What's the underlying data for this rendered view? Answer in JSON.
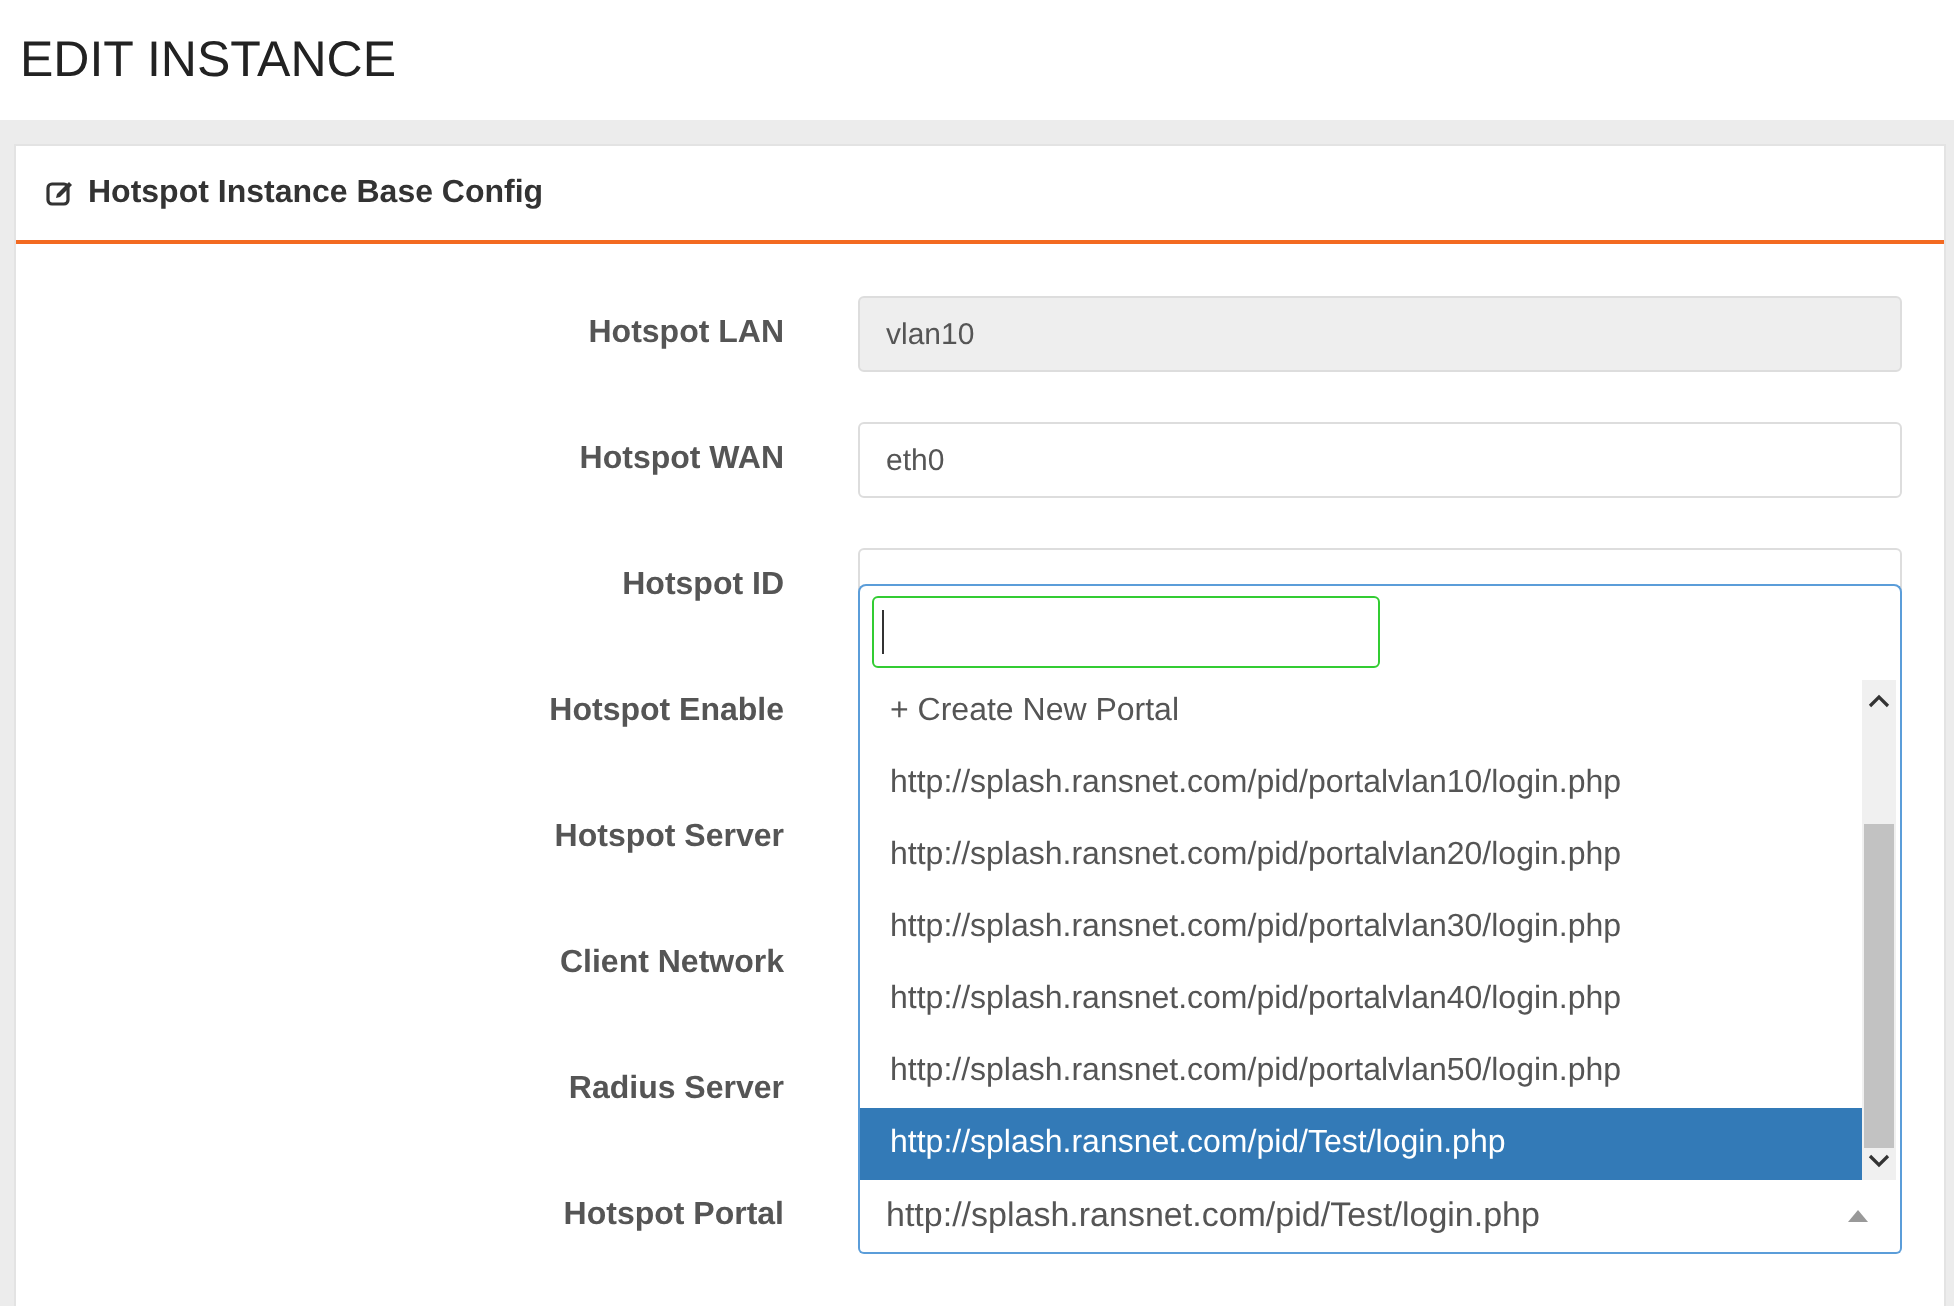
{
  "page_title": "EDIT INSTANCE",
  "panel": {
    "title": "Hotspot Instance Base Config",
    "fields": [
      {
        "label": "Hotspot LAN",
        "kind": "readonly",
        "value": "vlan10"
      },
      {
        "label": "Hotspot WAN",
        "kind": "input",
        "value": "eth0"
      },
      {
        "label": "Hotspot ID",
        "kind": "input"
      },
      {
        "label": "Hotspot Enable",
        "kind": "covered"
      },
      {
        "label": "Hotspot Server",
        "kind": "covered"
      },
      {
        "label": "Client Network",
        "kind": "covered"
      },
      {
        "label": "Radius Server",
        "kind": "covered"
      },
      {
        "label": "Hotspot Portal",
        "kind": "select",
        "value": "http://splash.ransnet.com/pid/Test/login.php",
        "expanded": true,
        "options": [
          {
            "label": "+ Create New Portal",
            "selected": false
          },
          {
            "label": "http://splash.ransnet.com/pid/portalvlan10/login.php",
            "selected": false
          },
          {
            "label": "http://splash.ransnet.com/pid/portalvlan20/login.php",
            "selected": false
          },
          {
            "label": "http://splash.ransnet.com/pid/portalvlan30/login.php",
            "selected": false
          },
          {
            "label": "http://splash.ransnet.com/pid/portalvlan40/login.php",
            "selected": false
          },
          {
            "label": "http://splash.ransnet.com/pid/portalvlan50/login.php",
            "selected": false
          },
          {
            "label": "http://splash.ransnet.com/pid/Test/login.php",
            "selected": true
          }
        ]
      }
    ]
  }
}
